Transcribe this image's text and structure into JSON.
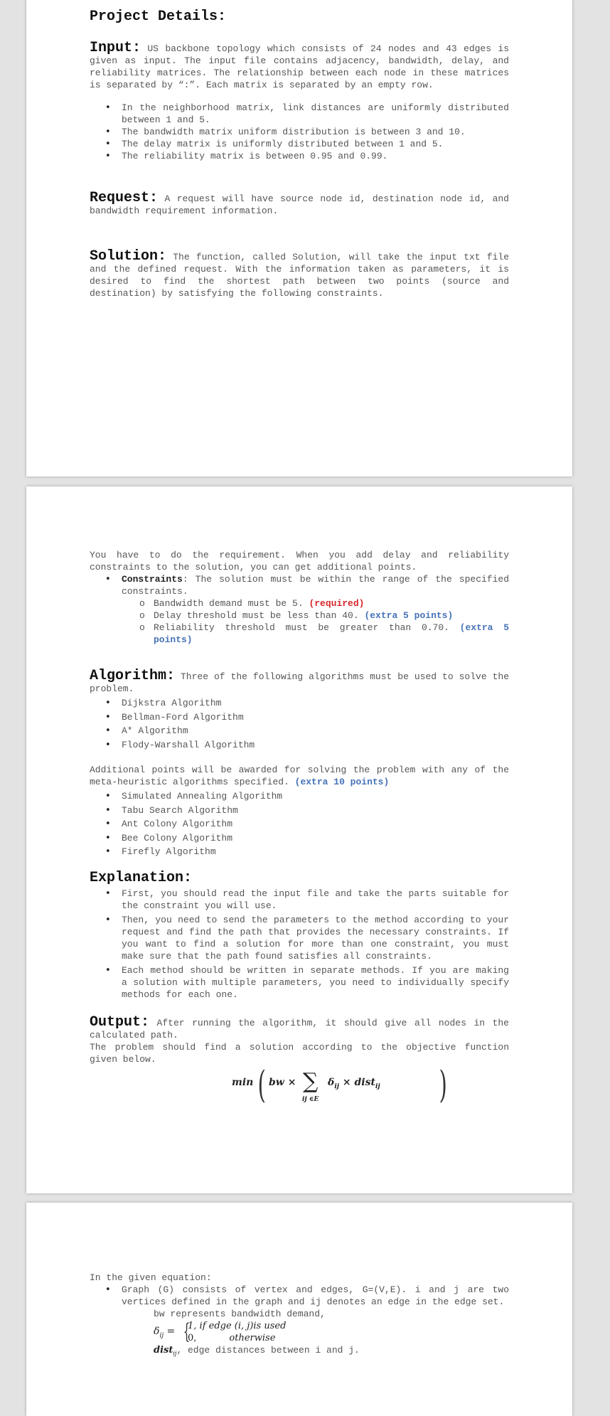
{
  "page1": {
    "title": "Project Details:",
    "input": {
      "heading": "Input:",
      "text": " US backbone topology which consists of 24 nodes and 43 edges is given as input. The input file contains adjacency, bandwidth, delay, and reliability matrices. The relationship between each node in these matrices is separated by “:”. Each matrix is separated by an empty row.",
      "bullets": [
        "In the neighborhood matrix, link distances are uniformly distributed between 1 and 5.",
        "The bandwidth matrix uniform distribution is between 3 and 10.",
        "The delay matrix is uniformly distributed between 1 and 5.",
        "The reliability matrix is between 0.95 and 0.99."
      ]
    },
    "request": {
      "heading": "Request:",
      "text": " A request will have source node id, destination node id, and bandwidth requirement information."
    },
    "solution": {
      "heading": "Solution:",
      "text": " The function, called Solution, will take the input txt file and the defined request. With the information taken as parameters, it is desired to find the shortest path between two points (source and destination) by satisfying the following constraints."
    }
  },
  "page2": {
    "intro": "You have to do the requirement. When you add delay and reliability constraints to the solution, you can get additional points.",
    "constraints": {
      "label": "Constraints",
      "text": ": The solution must be within the range of the specified constraints.",
      "items": [
        {
          "text": "Bandwidth demand must be 5. ",
          "tag": "(required)",
          "tag_color": "red"
        },
        {
          "text": "Delay threshold must be less than 40. ",
          "tag": "(extra 5 points)",
          "tag_color": "blue"
        },
        {
          "text": "Reliability threshold must be greater than 0.70. ",
          "tag": "(extra 5 points)",
          "tag_color": "blue"
        }
      ]
    },
    "algorithm": {
      "heading": "Algorithm:",
      "text": " Three of the following algorithms must be used to solve the problem.",
      "items": [
        "Dijkstra Algorithm",
        "Bellman-Ford Algorithm",
        "A* Algorithm",
        "Flody-Warshall Algorithm"
      ],
      "additional_text": "Additional points will be awarded for solving the problem with any of the meta-heuristic algorithms specified. ",
      "additional_tag": "(extra 10 points)",
      "meta_items": [
        "Simulated Annealing Algorithm",
        "Tabu Search Algorithm",
        "Ant Colony Algorithm",
        "Bee Colony Algorithm",
        "Firefly Algorithm"
      ]
    },
    "explanation": {
      "heading": "Explanation:",
      "items": [
        "First, you should read the input file and take the parts suitable for the constraint you will use.",
        "Then, you need to send the parameters to the method according to your request and find the path that provides the necessary constraints. If you want to find a solution for more than one constraint, you must make sure that the path found satisfies all constraints.",
        "Each method should be written in separate methods. If you are making a solution with multiple parameters, you need to individually specify methods for each one."
      ]
    },
    "output": {
      "heading": "Output:",
      "text": " After running the algorithm, it should give all nodes in the calculated path.",
      "text2": "The problem should find a solution according to the objective function given below.",
      "formula": {
        "min": "min",
        "bw": "bw ×",
        "sum": "∑",
        "sub": "ij ∈E",
        "term": "δ",
        "term_sub": "ij",
        "times": " × dist",
        "dist_sub": "ij"
      }
    }
  },
  "page3": {
    "intro": "In the given equation:",
    "bullet": "Graph (G) consists of vertex and edges, G=(V,E). i and j are two vertices defined in the graph and ij denotes an edge in the edge set.",
    "bw_line": "bw represents bandwidth demand,",
    "delta": {
      "symbol": "δ",
      "sub": "ij",
      "eq": " = ",
      "case1": "1, if edge (i, j)is used",
      "case2_val": "0,",
      "case2_cond": "otherwise"
    },
    "dist": {
      "symbol": "dist",
      "sub": "ij",
      "text": ", edge distances between i and j."
    }
  },
  "colors": {
    "required": "#d6262b",
    "extra": "#4672b8",
    "page_bg": "#ffffff",
    "viewer_bg": "#e3e3e3"
  }
}
